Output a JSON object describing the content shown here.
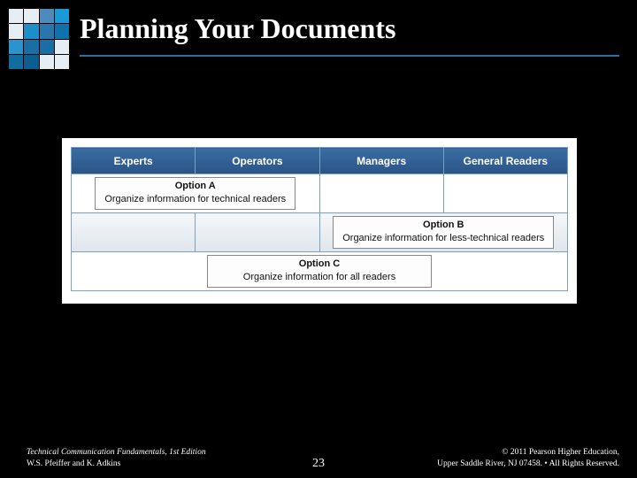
{
  "title": "Planning Your Documents",
  "columns": [
    "Experts",
    "Operators",
    "Managers",
    "General Readers"
  ],
  "options": {
    "a": {
      "label": "Option  A",
      "desc": "Organize information for technical readers"
    },
    "b": {
      "label": "Option B",
      "desc": "Organize information for less-technical readers"
    },
    "c": {
      "label": "Option C",
      "desc": "Organize information for all readers"
    }
  },
  "footer": {
    "left_line1": "Technical Communication Fundamentals, 1st Edition",
    "left_line2": "W.S. Pfeiffer and K. Adkins",
    "right_line1": "© 2011 Pearson Higher Education,",
    "right_line2": "Upper Saddle River, NJ 07458. • All Rights Reserved.",
    "page": "23"
  },
  "deco_colors": [
    "#e6eef4",
    "#e6eef4",
    "#4d8bbd",
    "#199ad6",
    "#e6eef4",
    "#1e8ec9",
    "#2876ad",
    "#0f72ab",
    "#2b94cd",
    "#1a6ea3",
    "#1a6ea3",
    "#e6eef4",
    "#136c9f",
    "#0b5e8f",
    "#e6eef4",
    "#e6eef4"
  ]
}
